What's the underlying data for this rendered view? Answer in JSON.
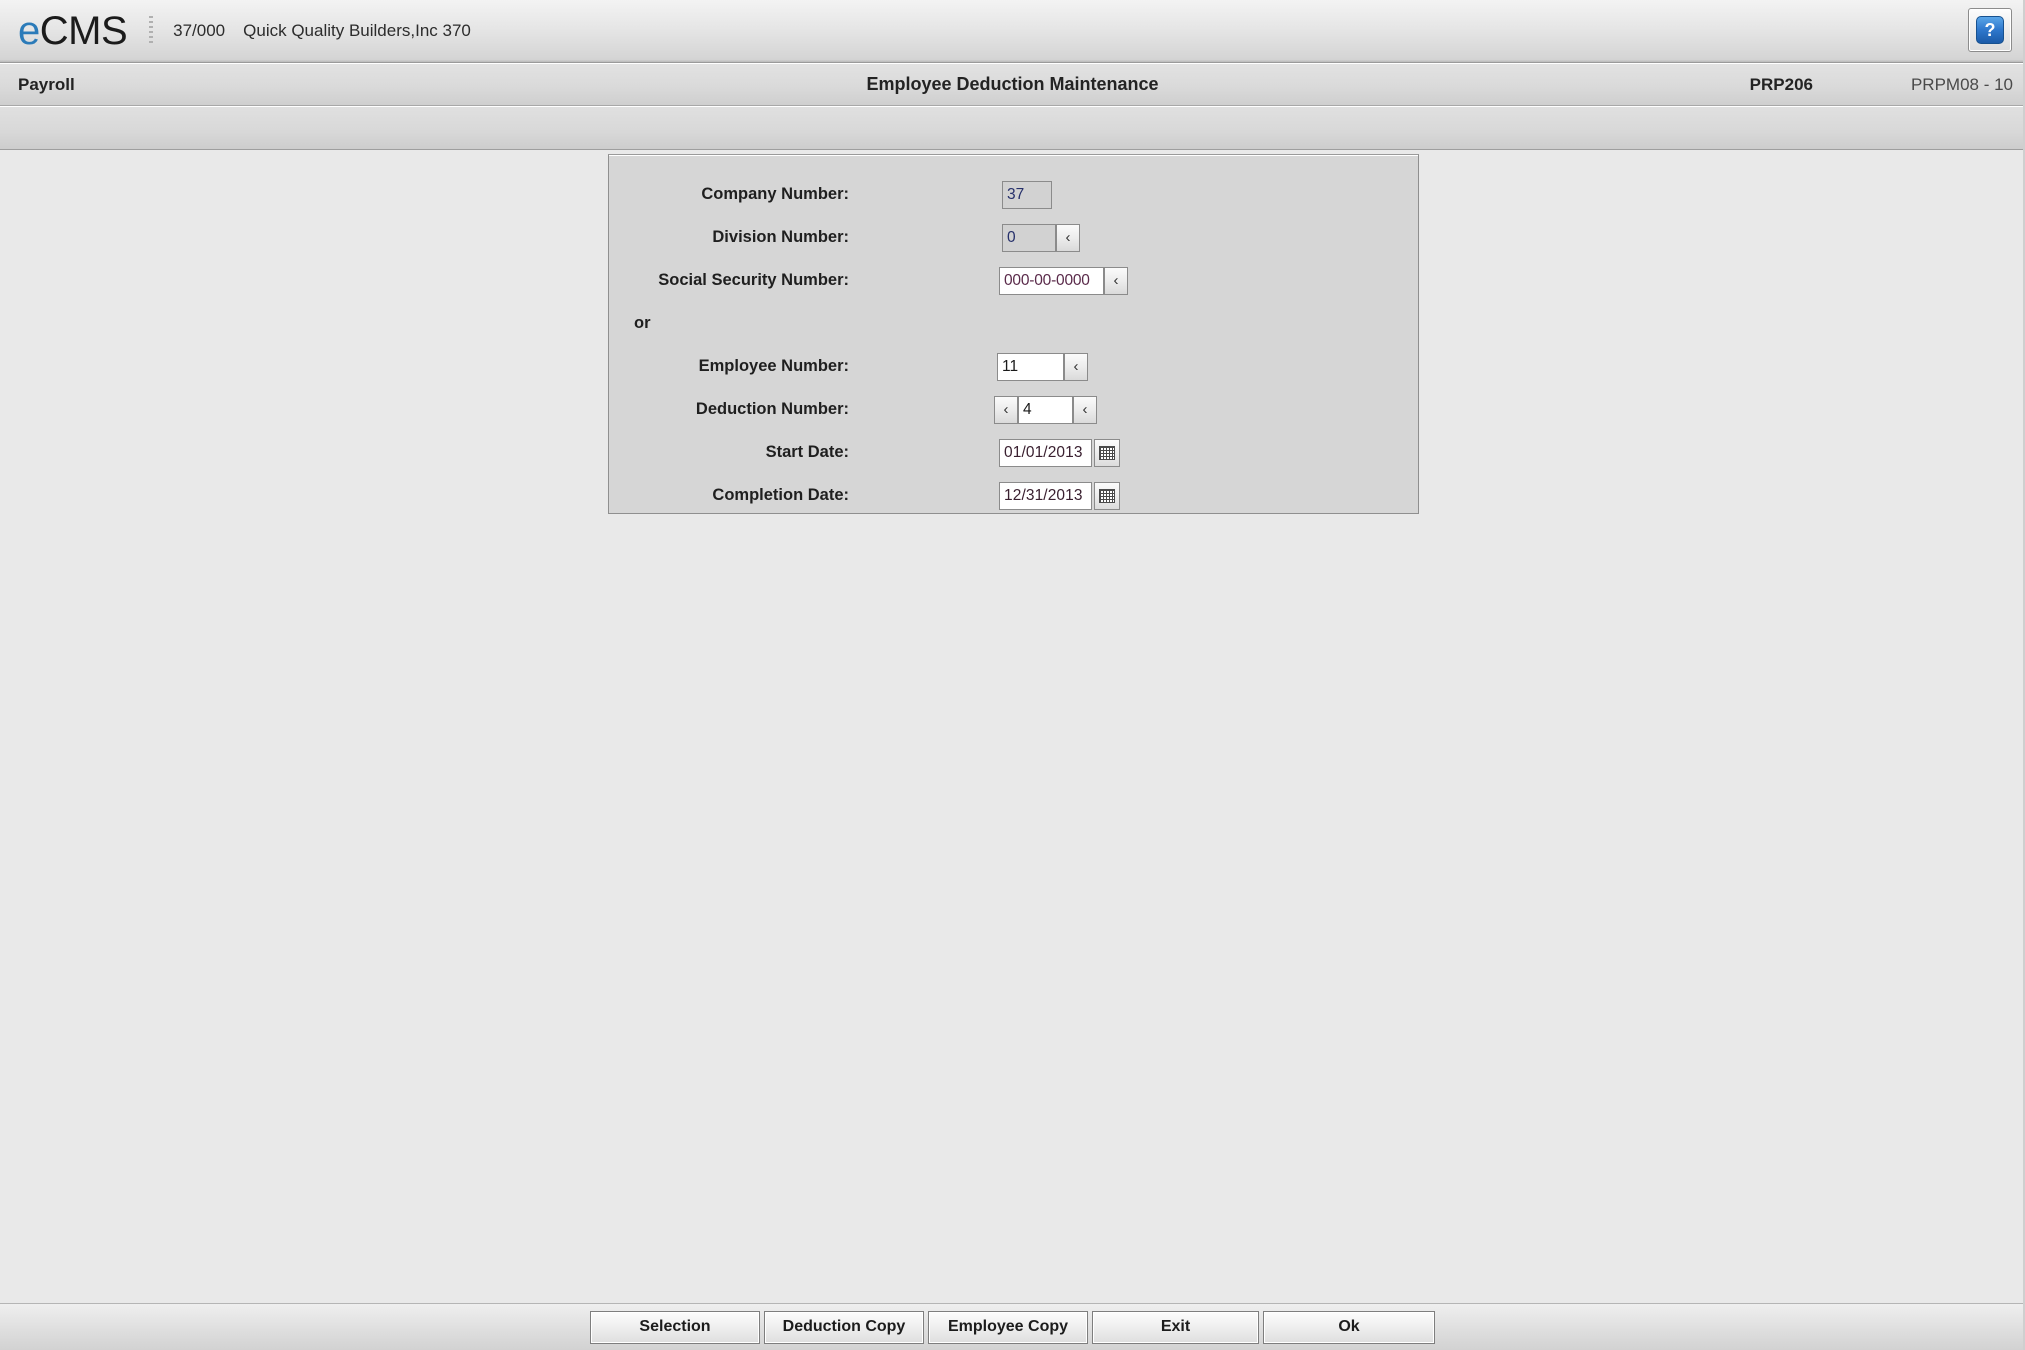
{
  "brand": {
    "logo_e": "e",
    "logo_cms": "CMS",
    "company_code": "37/000",
    "company_name": "Quick Quality Builders,Inc 370",
    "help_glyph": "?",
    "help_icon_name": "help-icon"
  },
  "titlebar": {
    "module": "Payroll",
    "title": "Employee Deduction Maintenance",
    "program_id": "PRP206",
    "screen_id": "PRPM08 - 10"
  },
  "form": {
    "rows": [
      {
        "label": "Company Number:",
        "value": "37",
        "readonly": true,
        "arrow": false
      },
      {
        "label": "Division Number:",
        "value": "0",
        "readonly": true,
        "arrow": true
      },
      {
        "label": "Social Security Number:",
        "value": "000-00-0000",
        "readonly": false,
        "arrow": true
      },
      {
        "label": "or",
        "value": "",
        "readonly": false,
        "arrow": false
      },
      {
        "label": "Employee Number:",
        "value": "11",
        "readonly": false,
        "arrow": true
      },
      {
        "label": "Deduction Number:",
        "value": "4",
        "readonly": false,
        "arrow": true
      },
      {
        "label": "Start Date:",
        "value": "01/01/2013",
        "readonly": false,
        "arrow": false
      },
      {
        "label": "Completion Date:",
        "value": "12/31/2013",
        "readonly": false,
        "arrow": false
      }
    ],
    "lookup_arrow_glyph": "‹",
    "calendar_icon_name": "calendar-icon"
  },
  "buttons": [
    {
      "label": "Selection"
    },
    {
      "label": "Deduction Copy"
    },
    {
      "label": "Employee Copy"
    },
    {
      "label": "Exit"
    },
    {
      "label": "Ok"
    }
  ],
  "colors": {
    "accent_blue": "#2b7bb9",
    "panel_gray": "#d6d6d6",
    "content_gray": "#e9e9e9",
    "input_text": "#26306b"
  }
}
